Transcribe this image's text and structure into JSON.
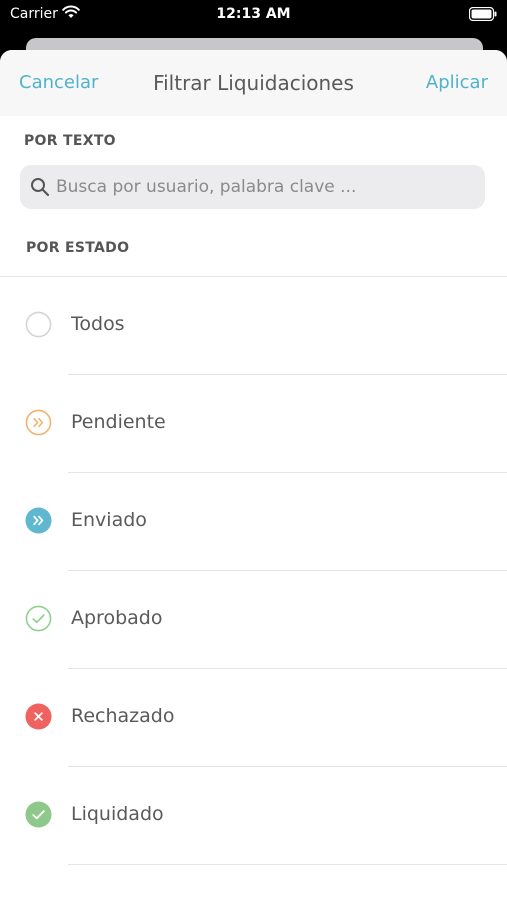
{
  "status_bar": {
    "carrier": "Carrier",
    "time": "12:13 AM"
  },
  "nav": {
    "cancel_label": "Cancelar",
    "title": "Filtrar Liquidaciones",
    "apply_label": "Aplicar"
  },
  "colors": {
    "accent": "#4fb3c9",
    "pending": "#f5b06c",
    "sent": "#5fb8d0",
    "approved": "#8dcf8c",
    "rejected": "#f0625f",
    "settled": "#8ec98b"
  },
  "text_section": {
    "label": "POR TEXTO",
    "search_placeholder": "Busca por usuario, palabra clave ..."
  },
  "state_section": {
    "label": "POR ESTADO",
    "items": [
      {
        "label": "Todos",
        "icon": "empty-circle-icon"
      },
      {
        "label": "Pendiente",
        "icon": "double-chevron-outline-icon"
      },
      {
        "label": "Enviado",
        "icon": "double-chevron-filled-icon"
      },
      {
        "label": "Aprobado",
        "icon": "check-outline-icon"
      },
      {
        "label": "Rechazado",
        "icon": "x-filled-icon"
      },
      {
        "label": "Liquidado",
        "icon": "check-filled-icon"
      }
    ]
  }
}
